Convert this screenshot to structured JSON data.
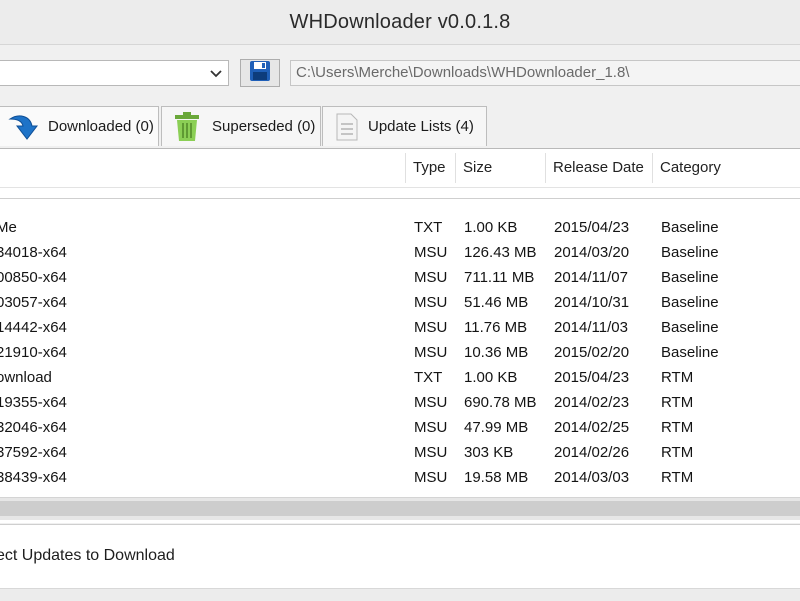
{
  "window": {
    "title": "WHDownloader v0.0.1.8"
  },
  "toolbar": {
    "selected_value": "",
    "path_value": "C:\\Users\\Merche\\Downloads\\WHDownloader_1.8\\"
  },
  "tabs": [
    {
      "label": "Downloaded (0)",
      "icon": "download-arrow-icon"
    },
    {
      "label": "Superseded (0)",
      "icon": "trash-bin-icon"
    },
    {
      "label": "Update Lists (4)",
      "icon": "document-icon"
    }
  ],
  "table": {
    "columns": [
      "Type",
      "Size",
      "Release Date",
      "Category"
    ],
    "rows": [
      {
        "name": "Me",
        "type": "TXT",
        "size": "1.00 KB",
        "date": "2015/04/23",
        "category": "Baseline"
      },
      {
        "name": "34018-x64",
        "type": "MSU",
        "size": "126.43 MB",
        "date": "2014/03/20",
        "category": "Baseline"
      },
      {
        "name": "00850-x64",
        "type": "MSU",
        "size": "711.11 MB",
        "date": "2014/11/07",
        "category": "Baseline"
      },
      {
        "name": "03057-x64",
        "type": "MSU",
        "size": "51.46 MB",
        "date": "2014/10/31",
        "category": "Baseline"
      },
      {
        "name": "14442-x64",
        "type": "MSU",
        "size": "11.76 MB",
        "date": "2014/11/03",
        "category": "Baseline"
      },
      {
        "name": "21910-x64",
        "type": "MSU",
        "size": "10.36 MB",
        "date": "2015/02/20",
        "category": "Baseline"
      },
      {
        "name": "ownload",
        "type": "TXT",
        "size": "1.00 KB",
        "date": "2015/04/23",
        "category": "RTM"
      },
      {
        "name": "19355-x64",
        "type": "MSU",
        "size": "690.78 MB",
        "date": "2014/02/23",
        "category": "RTM"
      },
      {
        "name": "32046-x64",
        "type": "MSU",
        "size": "47.99 MB",
        "date": "2014/02/25",
        "category": "RTM"
      },
      {
        "name": "37592-x64",
        "type": "MSU",
        "size": "303 KB",
        "date": "2014/02/26",
        "category": "RTM"
      },
      {
        "name": "38439-x64",
        "type": "MSU",
        "size": "19.58 MB",
        "date": "2014/03/03",
        "category": "RTM"
      }
    ]
  },
  "status": {
    "text": "ect Updates to Download"
  },
  "colors": {
    "accent_blue": "#1e73c8",
    "icon_green": "#7cc24a",
    "window_bg": "#f0f0f0"
  }
}
